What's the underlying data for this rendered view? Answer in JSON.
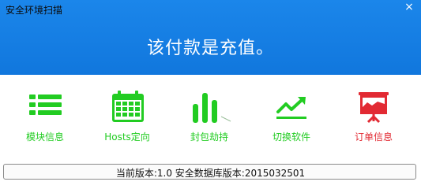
{
  "window": {
    "title": "安全环境扫描",
    "close_symbol": "×"
  },
  "header": {
    "headline": "该付款是充值。"
  },
  "features": [
    {
      "label": "模块信息",
      "icon": "list-icon",
      "color": "#22cc22"
    },
    {
      "label": "Hosts定向",
      "icon": "calendar-icon",
      "color": "#22cc22"
    },
    {
      "label": "封包劫持",
      "icon": "bar-chart-icon",
      "color": "#22cc22"
    },
    {
      "label": "切换软件",
      "icon": "trend-up-icon",
      "color": "#22cc22"
    },
    {
      "label": "订单信息",
      "icon": "presentation-chart-icon",
      "color": "#e22a33"
    }
  ],
  "status_bar": {
    "text": "当前版本:1.0 安全数据库版本:2015032501"
  }
}
